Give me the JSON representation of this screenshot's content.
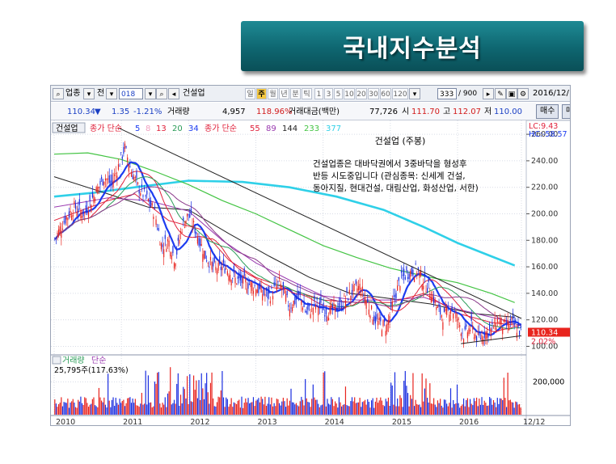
{
  "slide_title": "국내지수분석",
  "toolbar": {
    "code_label": "업종",
    "prev_label": "전",
    "code_value": "018",
    "name_value": "건설업",
    "period_labels": [
      "일",
      "주",
      "월",
      "년",
      "분",
      "틱"
    ],
    "active_period": "주",
    "minute_options": [
      "1",
      "3",
      "5",
      "10",
      "20",
      "30",
      "60",
      "120"
    ],
    "count_value": "333",
    "count_total": "/ 900",
    "date": "2016/12/12"
  },
  "quote": {
    "price": "110.34",
    "change_arrow": "▼",
    "change": "1.35",
    "change_pct": "-1.21%",
    "volume_label": "거래량",
    "volume": "4,957",
    "volume_ratio": "118.96%",
    "amount_label": "거래대금(백만)",
    "amount": "77,726",
    "open_label": "시",
    "open": "111.70",
    "high_label": "고",
    "high": "112.07",
    "low_label": "저",
    "low": "110.00",
    "buy_label": "매수",
    "sell_label": "매"
  },
  "colors": {
    "up_candle": "#e8241e",
    "down_candle": "#1a2ee0",
    "ma5": "#1c3cf0",
    "ma13": "#e0203a",
    "ma20": "#2a9c58",
    "ma34": "#8a3a8a",
    "ma89": "#9a3ab0",
    "ma144": "#222222",
    "ma233": "#43c443",
    "ma377": "#2fd0e8",
    "trendline": "#222222"
  },
  "chart_data": {
    "type": "candlestick",
    "title": "건설업 (주봉)",
    "annotation": [
      "건설업종은 대바닥권에서 3중바닥을 형성후",
      "반등 시도중입니다 (관심종목: 신세계 건설,",
      "동아지질, 현대건설, 대림산업, 화성산업, 서한)"
    ],
    "legend": {
      "prefix": "건설업",
      "items": [
        {
          "label": "종가 단순",
          "color": "#e0203a"
        },
        {
          "label": "5",
          "color": "#1c3cf0"
        },
        {
          "label": "8",
          "color": "#f0a0c0"
        },
        {
          "label": "13",
          "color": "#e0203a"
        },
        {
          "label": "20",
          "color": "#2a9c58"
        },
        {
          "label": "34",
          "color": "#1c3cf0"
        },
        {
          "label": "종가 단순",
          "color": "#e0203a"
        },
        {
          "label": "55",
          "color": "#e0203a"
        },
        {
          "label": "89",
          "color": "#9a3ab0"
        },
        {
          "label": "144",
          "color": "#222222"
        },
        {
          "label": "233",
          "color": "#43c443"
        },
        {
          "label": "377",
          "color": "#2fd0e8"
        }
      ]
    },
    "price_axis": {
      "labels": [
        "260.00",
        "240.00",
        "220.00",
        "200.00",
        "180.00",
        "160.00",
        "140.00",
        "120.00",
        "100.00"
      ],
      "values": [
        260,
        240,
        220,
        200,
        180,
        160,
        140,
        120,
        100
      ],
      "ylim": [
        96,
        268
      ]
    },
    "lc_label": "LC:9.43",
    "hc_label": "HC:-58.57",
    "last_price_tag": "110.34",
    "last_pct_tag": "2.02%",
    "x_axis": {
      "labels": [
        "2010",
        "2011",
        "2012",
        "2013",
        "2014",
        "2015",
        "2016",
        "12/12"
      ],
      "positions": [
        2010.0,
        2011.0,
        2012.0,
        2013.0,
        2014.0,
        2015.0,
        2016.0,
        2016.95
      ],
      "xlim": [
        2010.0,
        2016.95
      ]
    },
    "close_path": {
      "x": [
        2010.0,
        2010.15,
        2010.3,
        2010.45,
        2010.6,
        2010.75,
        2010.85,
        2010.95,
        2011.05,
        2011.15,
        2011.25,
        2011.4,
        2011.5,
        2011.6,
        2011.7,
        2011.8,
        2011.9,
        2012.0,
        2012.1,
        2012.25,
        2012.4,
        2012.55,
        2012.7,
        2012.85,
        2013.0,
        2013.1,
        2013.2,
        2013.35,
        2013.5,
        2013.65,
        2013.75,
        2013.9,
        2014.0,
        2014.1,
        2014.25,
        2014.4,
        2014.55,
        2014.7,
        2014.8,
        2014.95,
        2015.05,
        2015.15,
        2015.25,
        2015.4,
        2015.5,
        2015.6,
        2015.7,
        2015.8,
        2015.9,
        2016.0,
        2016.1,
        2016.2,
        2016.3,
        2016.4,
        2016.5,
        2016.6,
        2016.7,
        2016.8,
        2016.95
      ],
      "y": [
        180,
        195,
        205,
        200,
        215,
        228,
        222,
        235,
        250,
        232,
        220,
        210,
        200,
        175,
        180,
        165,
        190,
        200,
        188,
        168,
        158,
        160,
        150,
        148,
        145,
        140,
        138,
        148,
        130,
        138,
        125,
        132,
        128,
        126,
        130,
        140,
        145,
        128,
        118,
        115,
        135,
        150,
        155,
        158,
        148,
        142,
        128,
        122,
        130,
        120,
        108,
        115,
        105,
        110,
        112,
        120,
        115,
        118,
        110
      ]
    },
    "ma_lines": [
      {
        "name": "377",
        "color": "#2fd0e8",
        "x": [
          2010.0,
          2010.6,
          2011.2,
          2012.0,
          2012.8,
          2013.5,
          2014.2,
          2014.9,
          2015.5,
          2016.0,
          2016.5,
          2016.85
        ],
        "y": [
          213,
          216,
          220,
          225,
          224,
          220,
          213,
          203,
          190,
          178,
          168,
          161
        ]
      },
      {
        "name": "233",
        "color": "#43c443",
        "x": [
          2010.0,
          2010.5,
          2011.0,
          2011.5,
          2012.0,
          2012.5,
          2013.0,
          2013.5,
          2014.0,
          2014.5,
          2015.0,
          2015.5,
          2016.0,
          2016.5,
          2016.85
        ],
        "y": [
          245,
          246,
          241,
          232,
          222,
          210,
          200,
          188,
          176,
          167,
          159,
          153,
          148,
          140,
          133
        ]
      },
      {
        "name": "144",
        "color": "#222222",
        "x": [
          2010.0,
          2010.8,
          2011.4,
          2012.0,
          2012.6,
          2013.2,
          2013.8,
          2014.4,
          2015.0,
          2015.6,
          2016.2,
          2016.85
        ],
        "y": [
          228,
          215,
          205,
          203,
          185,
          168,
          152,
          140,
          136,
          132,
          125,
          122
        ]
      },
      {
        "name": "89",
        "color": "#9a3ab0",
        "x": [
          2010.0,
          2010.8,
          2011.4,
          2012.0,
          2012.5,
          2013.0,
          2013.5,
          2014.0,
          2014.5,
          2015.0,
          2015.5,
          2016.0,
          2016.5,
          2016.85
        ],
        "y": [
          205,
          212,
          210,
          202,
          180,
          163,
          150,
          138,
          135,
          135,
          137,
          128,
          122,
          118
        ]
      },
      {
        "name": "55",
        "color": "#e0203a",
        "x": [
          2010.0,
          2010.8,
          2011.2,
          2011.7,
          2012.2,
          2012.6,
          2013.0,
          2013.5,
          2014.0,
          2014.5,
          2015.0,
          2015.5,
          2016.0,
          2016.5,
          2016.85
        ],
        "y": [
          195,
          210,
          215,
          195,
          188,
          165,
          152,
          143,
          135,
          133,
          133,
          140,
          125,
          118,
          116
        ]
      }
    ],
    "trendlines": [
      {
        "x": [
          2010.95,
          2016.95
        ],
        "y": [
          265,
          121
        ]
      },
      {
        "x": [
          2016.05,
          2016.95
        ],
        "y": [
          102,
          108
        ]
      }
    ],
    "volume_panel": {
      "label": "거래량",
      "sublabel": "단순",
      "value_text": "25,795주(117.63%)",
      "axis_label": "200,000",
      "axis_value": 200000,
      "ylim": [
        0,
        300000
      ]
    }
  }
}
